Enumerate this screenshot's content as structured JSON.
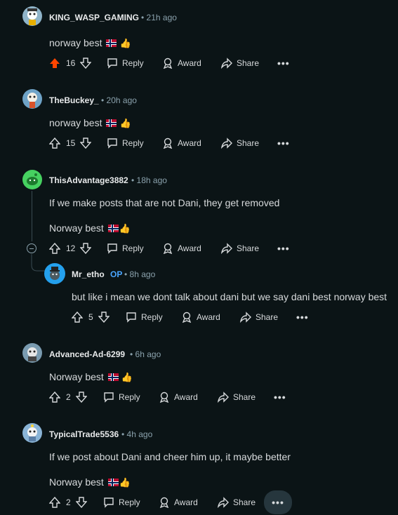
{
  "comments": [
    {
      "username": "KING_WASP_GAMING",
      "time": "21h ago",
      "body": "norway best",
      "flag": true,
      "thumb": true,
      "votes": "16",
      "upvoted": true
    },
    {
      "username": "TheBuckey_",
      "time": "20h ago",
      "body": "norway best",
      "flag": true,
      "thumb": true,
      "votes": "15"
    },
    {
      "username": "ThisAdvantage3882",
      "time": "18h ago",
      "body": "If we make posts that are not Dani, they get removed",
      "body2": "Norway best",
      "votes": "12"
    },
    {
      "username": "Mr_etho",
      "op": "OP",
      "time": "8h ago",
      "body": "but like i mean we dont talk about dani but we say dani best norway best",
      "votes": "5"
    },
    {
      "username": "Advanced-Ad-6299",
      "time": "6h ago",
      "body": "Norway best",
      "votes": "2"
    },
    {
      "username": "TypicalTrade5536",
      "time": "4h ago",
      "body": "If we post about Dani and cheer him up, it maybe better",
      "body2": "Norway best",
      "votes": "2"
    }
  ],
  "labels": {
    "reply": "Reply",
    "award": "Award",
    "share": "Share",
    "more": "•••",
    "dot": "•",
    "thumb": "👍"
  },
  "colors": {
    "background": "#0b1416",
    "upvote_active": "#ff4500",
    "op": "#4aa6ff",
    "meta": "#8ba2ad"
  },
  "icons": [
    "upvote-icon",
    "downvote-icon",
    "comment-icon",
    "award-icon",
    "share-icon",
    "more-icon",
    "collapse-icon"
  ]
}
